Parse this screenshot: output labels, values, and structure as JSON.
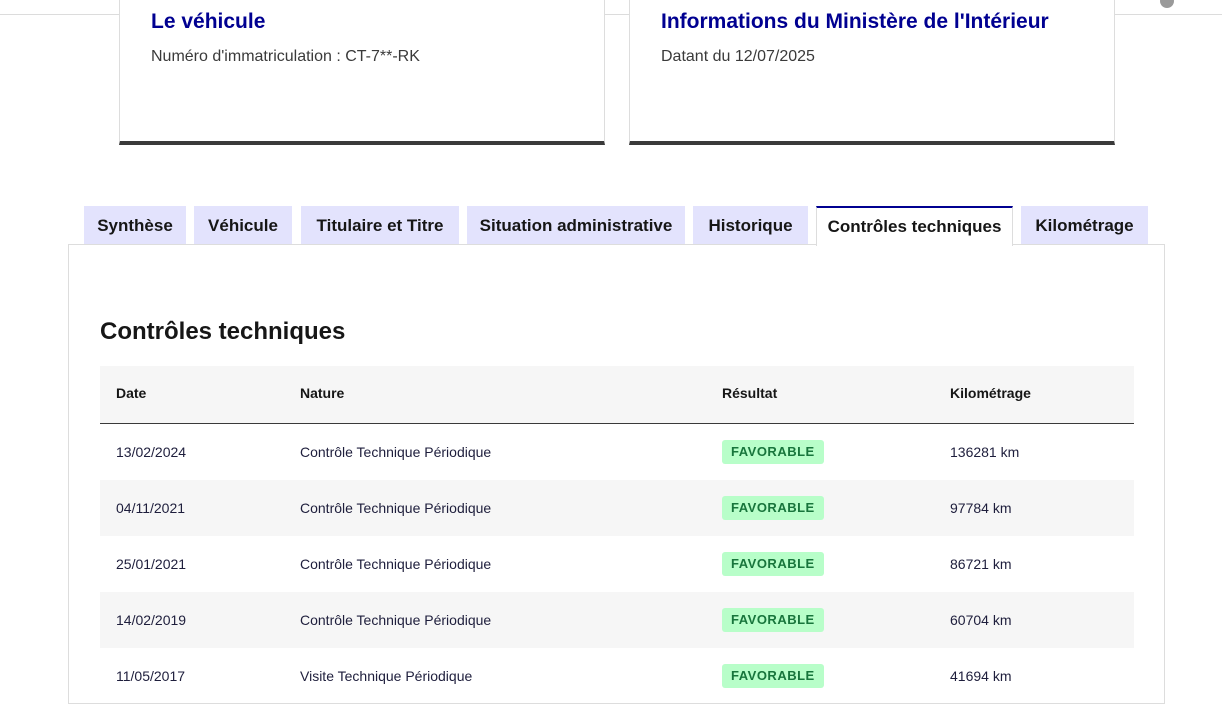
{
  "vehicle_card": {
    "title": "Le véhicule",
    "subtitle": "Numéro d'immatriculation : CT-7**-RK"
  },
  "ministry_card": {
    "title": "Informations du Ministère de l'Intérieur",
    "subtitle": "Datant du 12/07/2025"
  },
  "tabs": [
    {
      "label": "Synthèse",
      "active": false
    },
    {
      "label": "Véhicule",
      "active": false
    },
    {
      "label": "Titulaire et Titre",
      "active": false
    },
    {
      "label": "Situation administrative",
      "active": false
    },
    {
      "label": "Historique",
      "active": false
    },
    {
      "label": "Contrôles techniques",
      "active": true
    },
    {
      "label": "Kilométrage",
      "active": false
    }
  ],
  "section": {
    "title": "Contrôles techniques"
  },
  "table": {
    "headers": [
      "Date",
      "Nature",
      "Résultat",
      "Kilométrage"
    ],
    "rows": [
      {
        "date": "13/02/2024",
        "nature": "Contrôle Technique Périodique",
        "result": "FAVORABLE",
        "km": "136281 km"
      },
      {
        "date": "04/11/2021",
        "nature": "Contrôle Technique Périodique",
        "result": "FAVORABLE",
        "km": "97784 km"
      },
      {
        "date": "25/01/2021",
        "nature": "Contrôle Technique Périodique",
        "result": "FAVORABLE",
        "km": "86721 km"
      },
      {
        "date": "14/02/2019",
        "nature": "Contrôle Technique Périodique",
        "result": "FAVORABLE",
        "km": "60704 km"
      },
      {
        "date": "11/05/2017",
        "nature": "Visite Technique Périodique",
        "result": "FAVORABLE",
        "km": "41694 km"
      }
    ]
  },
  "colors": {
    "primary": "#000091",
    "tab_bg": "#e3e3fd",
    "badge_bg": "#b8fec9",
    "badge_text": "#18753c",
    "row_alt": "#f6f6f6"
  }
}
